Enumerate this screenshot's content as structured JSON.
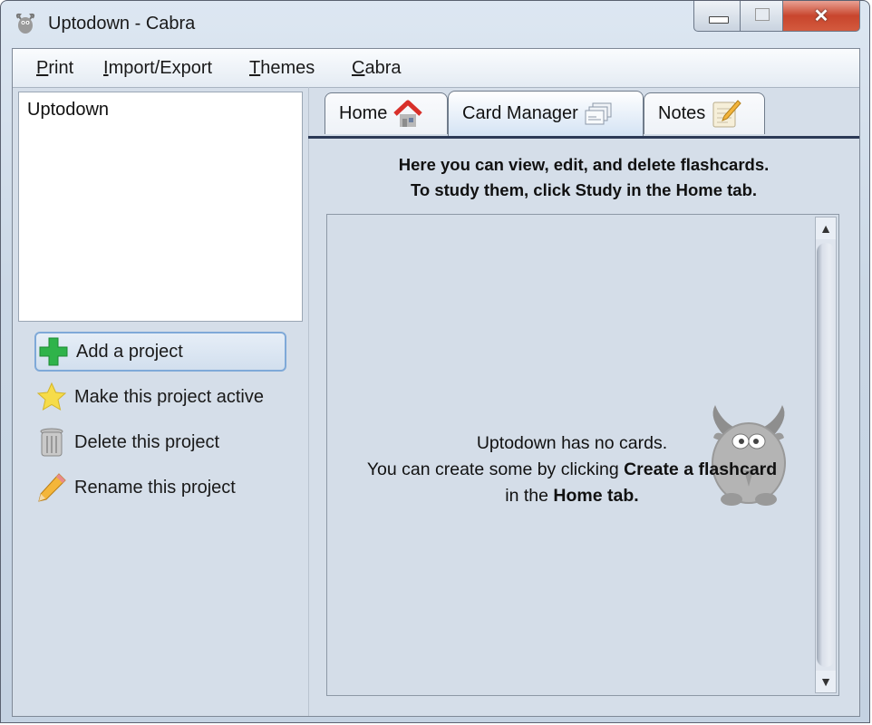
{
  "window": {
    "title": "Uptodown - Cabra",
    "controls": {
      "minimize": "minimize",
      "maximize": "maximize",
      "close": "✕"
    }
  },
  "menubar": {
    "items": [
      {
        "label": "Print",
        "mnemonic": "P",
        "rest": "rint"
      },
      {
        "label": "Import/Export",
        "mnemonic": "I",
        "rest": "mport/Export"
      },
      {
        "label": "Themes",
        "mnemonic": "T",
        "rest": "hemes"
      },
      {
        "label": "Cabra",
        "mnemonic": "C",
        "rest": "abra"
      }
    ]
  },
  "projects": {
    "items": [
      "Uptodown"
    ]
  },
  "actions": [
    {
      "label": "Add a project",
      "icon": "plus-icon",
      "focused": true
    },
    {
      "label": "Make this project active",
      "icon": "star-icon"
    },
    {
      "label": "Delete this project",
      "icon": "trash-icon"
    },
    {
      "label": "Rename this project",
      "icon": "pencil-icon"
    }
  ],
  "tabs": [
    {
      "label": "Home",
      "icon": "house-icon",
      "active": false
    },
    {
      "label": "Card Manager",
      "icon": "cards-icon",
      "active": true
    },
    {
      "label": "Notes",
      "icon": "notepad-icon",
      "active": false
    }
  ],
  "card_manager": {
    "info_line1": "Here you can view, edit, and delete flashcards.",
    "info_line2": "To study them, click Study in the Home tab.",
    "empty_line1": "Uptodown has no cards.",
    "empty_line2_plain": "You can create some by clicking ",
    "empty_line2_bold": "Create a flashcard",
    "empty_line3_plain": "in the ",
    "empty_line3_bold": "Home tab.",
    "scroll_up": "▲",
    "scroll_down": "▼"
  },
  "colors": {
    "close_button": "#c8452d",
    "focus_border": "#7fa9d8",
    "tab_underline": "#2c3a56"
  }
}
